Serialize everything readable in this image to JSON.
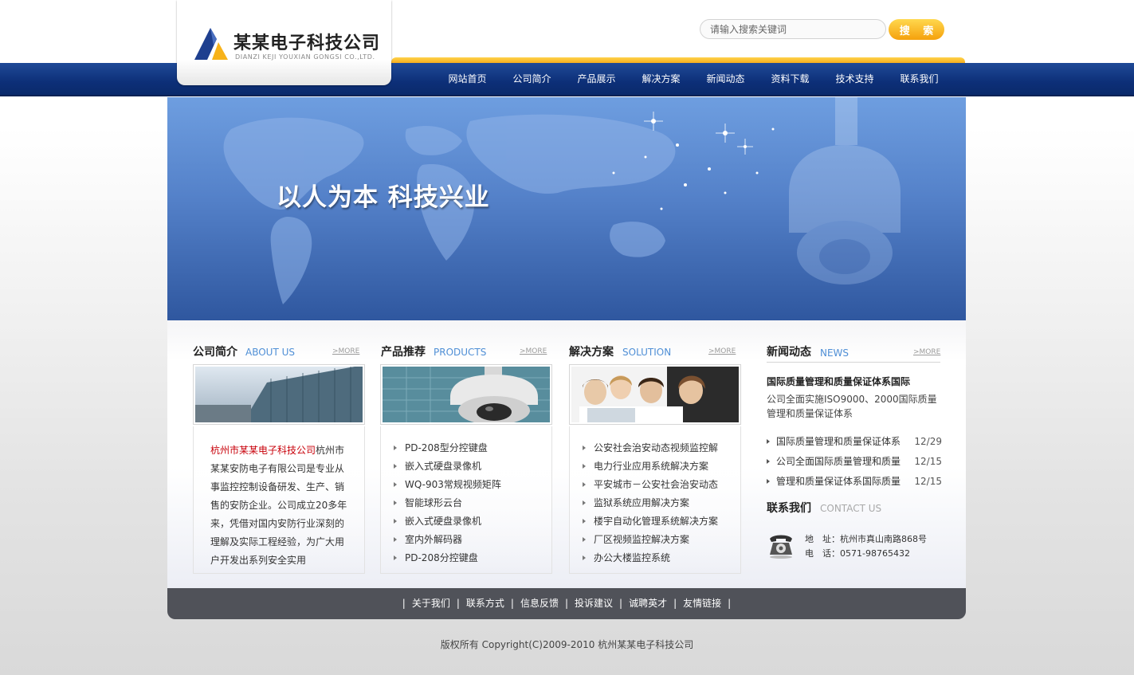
{
  "brand": {
    "name_cn": "某某电子科技公司",
    "name_en": "DIANZI KEJI YOUXIAN GONGSI CO.,LTD."
  },
  "search": {
    "placeholder": "请输入搜索关键词",
    "button_label": "搜 索"
  },
  "nav": {
    "items": [
      "网站首页",
      "公司简介",
      "产品展示",
      "解决方案",
      "新闻动态",
      "资料下载",
      "技术支持",
      "联系我们"
    ]
  },
  "banner": {
    "slogan": "以人为本 科技兴业"
  },
  "sections": {
    "about": {
      "title_cn": "公司简介",
      "title_en": "ABOUT US",
      "more": ">MORE",
      "intro_highlight": "杭州市某某电子科技公司",
      "intro_body": "杭州市某某安防电子有限公司是专业从事监控控制设备研发、生产、销售的安防企业。公司成立20多年来，凭借对国内安防行业深刻的理解及实际工程经验，为广大用户开发出系列安全实用"
    },
    "products": {
      "title_cn": "产品推荐",
      "title_en": "PRODUCTS",
      "more": ">MORE",
      "items": [
        "PD-208型分控键盘",
        "嵌入式硬盘录像机",
        "WQ-903常规视频矩阵",
        "智能球形云台",
        "嵌入式硬盘录像机",
        "室内外解码器",
        "PD-208分控键盘"
      ]
    },
    "solutions": {
      "title_cn": "解决方案",
      "title_en": "SOLUTION",
      "more": ">MORE",
      "items": [
        "公安社会治安动态视频监控解",
        "电力行业应用系统解决方案",
        "平安城市－公安社会治安动态",
        "监狱系统应用解决方案",
        "楼宇自动化管理系统解决方案",
        "厂区视频监控解决方案",
        "办公大楼监控系统"
      ]
    },
    "news": {
      "title_cn": "新闻动态",
      "title_en": "NEWS",
      "more": ">MORE",
      "headline": "国际质量管理和质量保证体系国际",
      "summary": "公司全面实施ISO9000、2000国际质量管理和质量保证体系",
      "items": [
        {
          "title": "国际质量管理和质量保证体系",
          "date": "12/29"
        },
        {
          "title": "公司全面国际质量管理和质量",
          "date": "12/15"
        },
        {
          "title": "管理和质量保证体系国际质量",
          "date": "12/15"
        }
      ]
    },
    "contact": {
      "title_cn": "联系我们",
      "title_en": "CONTACT US",
      "address_label": "地　址：",
      "address": "杭州市真山南路868号",
      "phone_label": "电　话：",
      "phone": "0571-98765432"
    }
  },
  "footer": {
    "links": [
      "关于我们",
      "联系方式",
      "信息反馈",
      "投诉建议",
      "诚聘英才",
      "友情链接"
    ],
    "copyright": "版权所有 Copyright(C)2009-2010 杭州某某电子科技公司"
  },
  "colors": {
    "nav_bg": "#0d2f78",
    "accent_yellow": "#f5a818",
    "highlight_red": "#c8000a",
    "section_en": "#4f8fd6",
    "footer_bg": "#505259"
  }
}
